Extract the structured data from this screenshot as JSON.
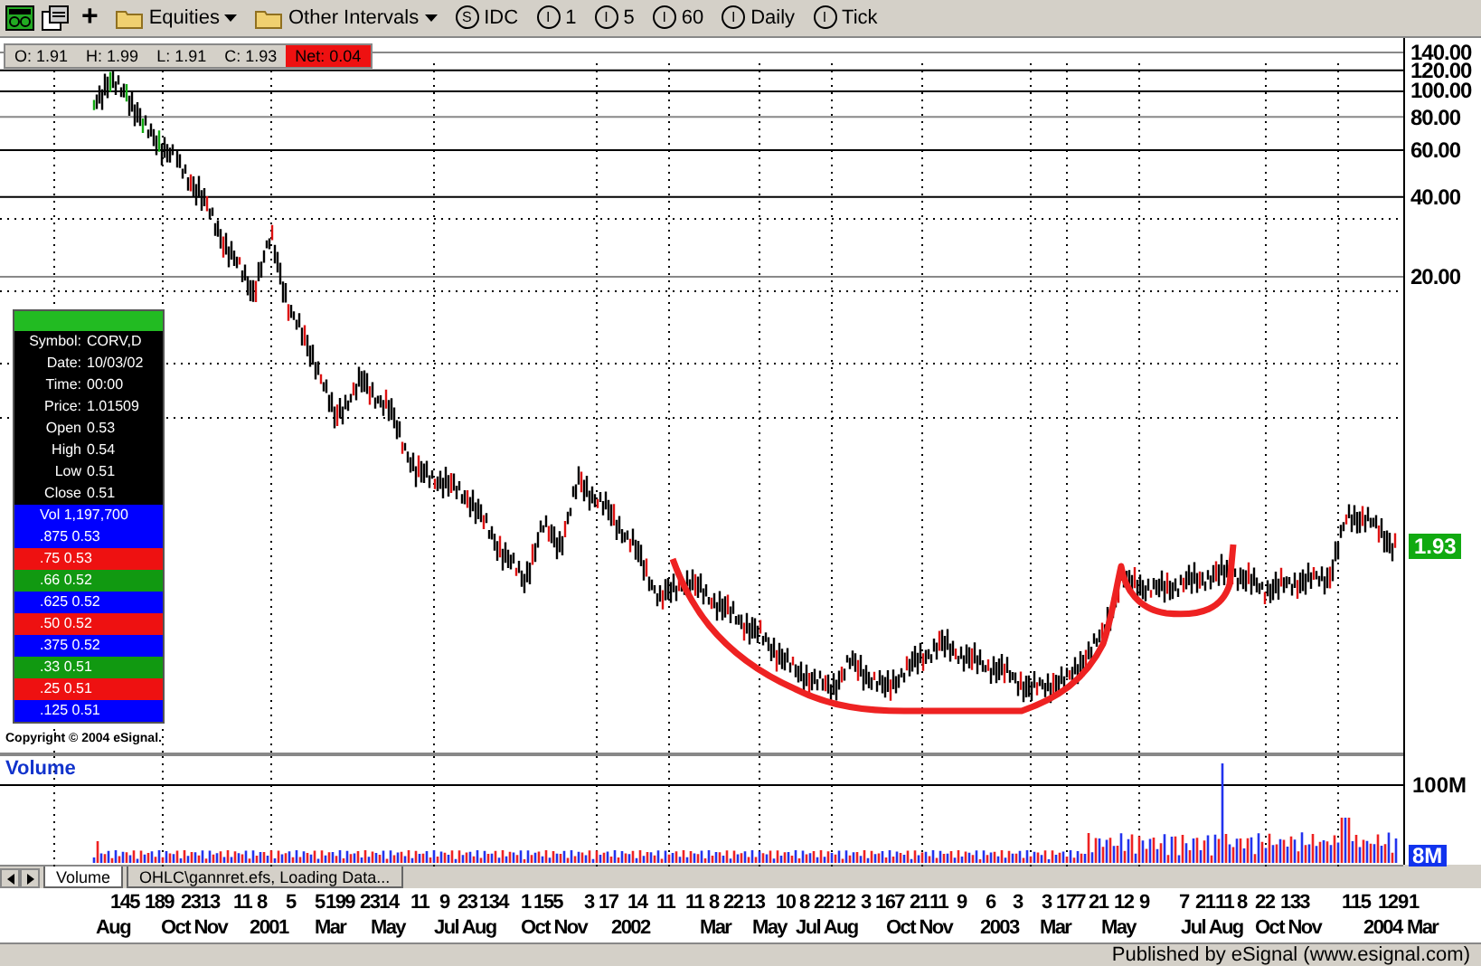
{
  "toolbar": [
    {
      "kind": "plus",
      "label": "+"
    },
    {
      "kind": "menu",
      "label": "Equities"
    },
    {
      "kind": "menu",
      "label": "Other Intervals"
    },
    {
      "kind": "interval",
      "badge": "S",
      "label": "IDC"
    },
    {
      "kind": "interval",
      "badge": "I",
      "label": "1"
    },
    {
      "kind": "interval",
      "badge": "I",
      "label": "5"
    },
    {
      "kind": "interval",
      "badge": "I",
      "label": "60"
    },
    {
      "kind": "interval",
      "badge": "I",
      "label": "Daily"
    },
    {
      "kind": "interval",
      "badge": "I",
      "label": "Tick"
    }
  ],
  "readout": [
    {
      "text": "O: 1.91",
      "kind": "plain"
    },
    {
      "text": "H: 1.99",
      "kind": "plain"
    },
    {
      "text": "L: 1.91",
      "kind": "plain"
    },
    {
      "text": "C: 1.93",
      "kind": "plain"
    },
    {
      "text": "Net: 0.04",
      "kind": "net"
    }
  ],
  "price_axis": {
    "labels": [
      "140.00",
      "120.00",
      "100.00",
      "80.00",
      "60.00",
      "40.00",
      "20.00"
    ],
    "last_price": "1.93"
  },
  "cursor_window": {
    "fields": [
      {
        "label": "Symbol:",
        "value": "CORV,D"
      },
      {
        "label": "Date:",
        "value": "10/03/02"
      },
      {
        "label": "Time:",
        "value": "00:00"
      },
      {
        "label": "Price:",
        "value": "1.01509"
      },
      {
        "label": "Open",
        "value": "0.53"
      },
      {
        "label": "High",
        "value": "0.54"
      },
      {
        "label": "Low",
        "value": "0.51"
      },
      {
        "label": "Close",
        "value": "0.51"
      }
    ],
    "levels": [
      {
        "text": "Vol 1,197,700",
        "color": "#0000ff"
      },
      {
        "text": ".875 0.53",
        "color": "#0000ff"
      },
      {
        "text": ".75 0.53",
        "color": "#ee1111"
      },
      {
        "text": ".66 0.52",
        "color": "#119911"
      },
      {
        "text": ".625 0.52",
        "color": "#0000ff"
      },
      {
        "text": ".50 0.52",
        "color": "#ee1111"
      },
      {
        "text": ".375 0.52",
        "color": "#0000ff"
      },
      {
        "text": ".33 0.51",
        "color": "#119911"
      },
      {
        "text": ".25 0.51",
        "color": "#ee1111"
      },
      {
        "text": ".125 0.51",
        "color": "#0000ff"
      }
    ]
  },
  "copyright": "Copyright © 2004 eSignal.",
  "volume_pane": {
    "title": "Volume",
    "axis_labels": [
      "100M",
      "8M"
    ]
  },
  "tabs": [
    {
      "label": "Volume",
      "selected": true
    },
    {
      "label": "OHLC\\gannret.efs, Loading Data...",
      "selected": false
    }
  ],
  "x_axis": {
    "day_labels": [
      "145",
      "189",
      "2313",
      "11",
      "8",
      "5",
      "5",
      "199",
      "2314",
      "11",
      "9",
      "23",
      "134",
      "1",
      "155",
      "3",
      "17",
      "14",
      "11",
      "11",
      "8",
      "22",
      "13",
      "10",
      "8",
      "22",
      "12",
      "3",
      "167",
      "21",
      "11",
      "9",
      "6",
      "3",
      "3",
      "177",
      "21",
      "12",
      "9",
      "7",
      "21",
      "11",
      "8",
      "22",
      "133",
      "1",
      "15",
      "12",
      "9",
      "1"
    ],
    "month_labels": [
      "Aug",
      "Oct Nov",
      "2001",
      "Mar",
      "May",
      "Jul Aug",
      "Oct Nov",
      "2002",
      "Mar",
      "May",
      "Jul Aug",
      "Oct Nov",
      "2003",
      "Mar",
      "May",
      "Jul Aug",
      "Oct Nov",
      "2004",
      "Mar"
    ]
  },
  "status_bar": "Published by eSignal (www.esignal.com)"
}
